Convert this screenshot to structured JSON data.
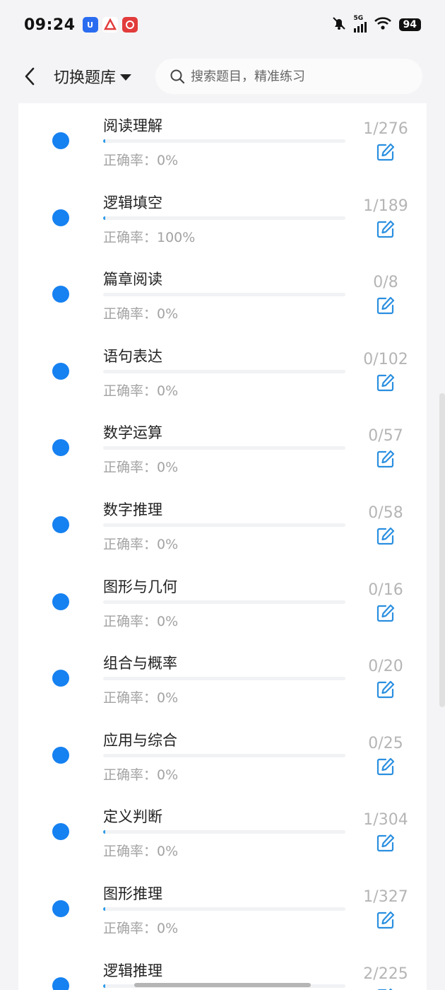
{
  "status": {
    "time": "09:24",
    "battery": "94",
    "network": "5G"
  },
  "header": {
    "switch_label": "切换题库",
    "search_placeholder": "搜索题目，精准练习"
  },
  "colors": {
    "accent": "#1681f1",
    "progress": "#2f9be8",
    "muted": "#a3a3a3"
  },
  "items": [
    {
      "title": "阅读理解",
      "accuracy": "正确率：0%",
      "count": "1/276",
      "progress": 0.0036
    },
    {
      "title": "逻辑填空",
      "accuracy": "正确率：100%",
      "count": "1/189",
      "progress": 0.0053
    },
    {
      "title": "篇章阅读",
      "accuracy": "正确率：0%",
      "count": "0/8",
      "progress": 0
    },
    {
      "title": "语句表达",
      "accuracy": "正确率：0%",
      "count": "0/102",
      "progress": 0
    },
    {
      "title": "数学运算",
      "accuracy": "正确率：0%",
      "count": "0/57",
      "progress": 0
    },
    {
      "title": "数字推理",
      "accuracy": "正确率：0%",
      "count": "0/58",
      "progress": 0
    },
    {
      "title": "图形与几何",
      "accuracy": "正确率：0%",
      "count": "0/16",
      "progress": 0
    },
    {
      "title": "组合与概率",
      "accuracy": "正确率：0%",
      "count": "0/20",
      "progress": 0
    },
    {
      "title": "应用与综合",
      "accuracy": "正确率：0%",
      "count": "0/25",
      "progress": 0
    },
    {
      "title": "定义判断",
      "accuracy": "正确率：0%",
      "count": "1/304",
      "progress": 0.0033
    },
    {
      "title": "图形推理",
      "accuracy": "正确率：0%",
      "count": "1/327",
      "progress": 0.0031
    },
    {
      "title": "逻辑推理",
      "accuracy": "",
      "count": "2/225",
      "progress": 0.0089
    }
  ]
}
